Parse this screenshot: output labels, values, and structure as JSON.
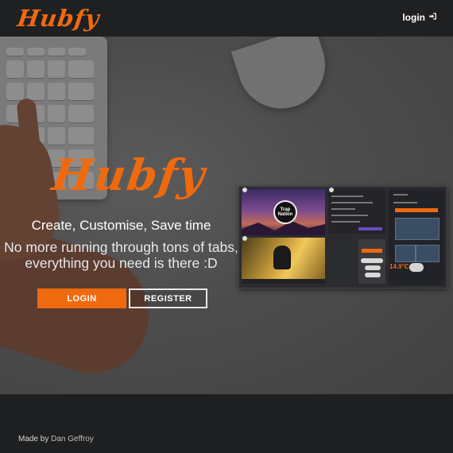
{
  "header": {
    "brand": "Hubfy",
    "login_label": "login",
    "login_icon": "sign-in-icon"
  },
  "hero": {
    "logo": "Hubfy",
    "tagline": "Create, Customise, Save time",
    "subline": "No more running through tons of tabs, everything you need is there :D",
    "login_button": "LOGIN",
    "register_button": "REGISTER"
  },
  "preview": {
    "badge_text": "Trap Nation",
    "temperature": "14.9°C"
  },
  "footer": {
    "made_by": "Made by",
    "author": "Dan Geffroy"
  },
  "colors": {
    "accent": "#ef6a0f",
    "header_bg": "#1f2022",
    "footer_bg": "#1e1f21"
  }
}
